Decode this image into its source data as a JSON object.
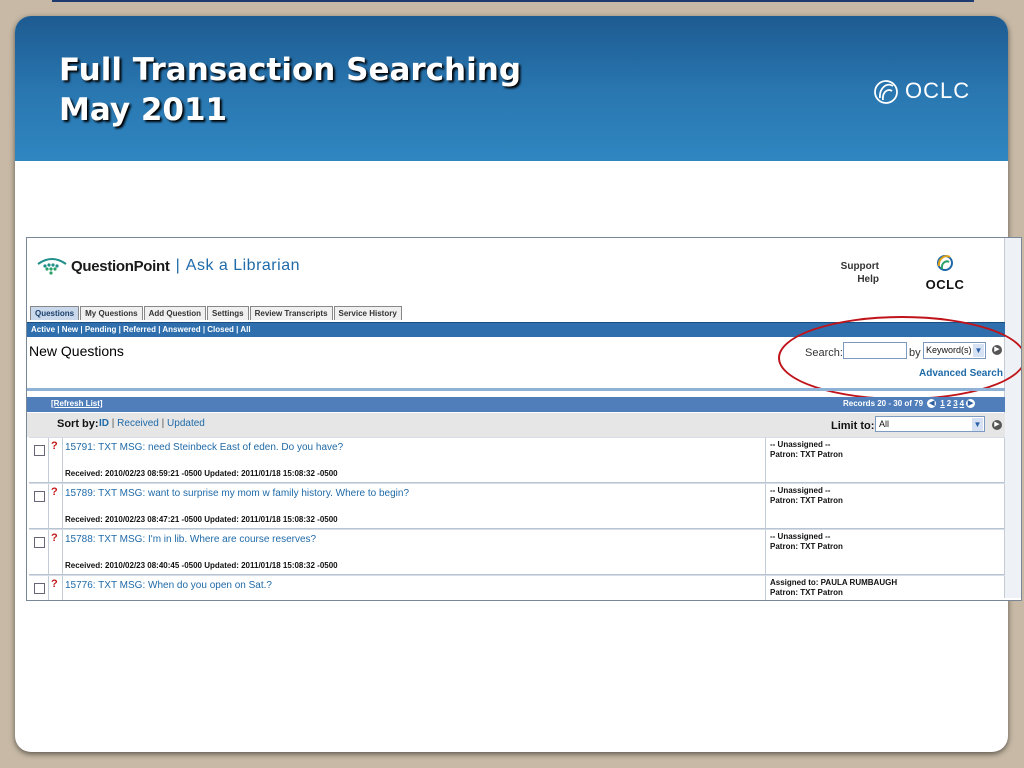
{
  "slide": {
    "title_line1": "Full Transaction Searching",
    "title_line2": "May 2011",
    "logo_text": "OCLC",
    "logo_icon": "oclc-logo-icon"
  },
  "app": {
    "brand": "QuestionPoint",
    "tagline": "Ask a Librarian",
    "support": "Support",
    "help": "Help",
    "oclc_logo_text": "OCLC",
    "tabs": [
      "Questions",
      "My Questions",
      "Add Question",
      "Settings",
      "Review Transcripts",
      "Service History"
    ],
    "subnav": "Active | New | Pending | Referred | Answered | Closed | All",
    "page_heading": "New Questions",
    "search": {
      "label": "Search:",
      "value": "",
      "by_label": "by",
      "by_selected": "Keyword(s)",
      "advanced": "Advanced Search"
    },
    "list": {
      "refresh": "[Refresh List]",
      "records": "Records 20 - 30 of 79",
      "pages": [
        "1",
        "2",
        "3",
        "4"
      ],
      "sort_label": "Sort by:",
      "sort_id": "ID",
      "sort_received": "Received",
      "sort_updated": "Updated",
      "sort_sep": "|",
      "limit_label": "Limit to:",
      "limit_selected": "All"
    },
    "rows": [
      {
        "subject": "15791: TXT MSG: need Steinbeck East of eden. Do you have?",
        "meta": "Received: 2010/02/23 08:59:21 -0500 Updated: 2011/01/18 15:08:32 -0500",
        "assigned": "-- Unassigned --",
        "patron": "Patron: TXT Patron"
      },
      {
        "subject": "15789: TXT MSG: want to surprise my mom w family history. Where to begin?",
        "meta": "Received: 2010/02/23 08:47:21 -0500 Updated: 2011/01/18 15:08:32 -0500",
        "assigned": "-- Unassigned --",
        "patron": "Patron: TXT Patron"
      },
      {
        "subject": "15788: TXT MSG: I'm in lib. Where are course reserves?",
        "meta": "Received: 2010/02/23 08:40:45 -0500 Updated: 2011/01/18 15:08:32 -0500",
        "assigned": "-- Unassigned --",
        "patron": "Patron: TXT Patron"
      },
      {
        "subject": "15776: TXT MSG: When do you open on Sat.?",
        "meta": "",
        "assigned": "Assigned to: PAULA RUMBAUGH",
        "patron": "Patron: TXT Patron"
      }
    ],
    "flag_symbol": "?",
    "colors": {
      "header_blue": "#2a78b2",
      "link_blue": "#1f6aa8",
      "highlight_red": "#c0141b"
    }
  }
}
